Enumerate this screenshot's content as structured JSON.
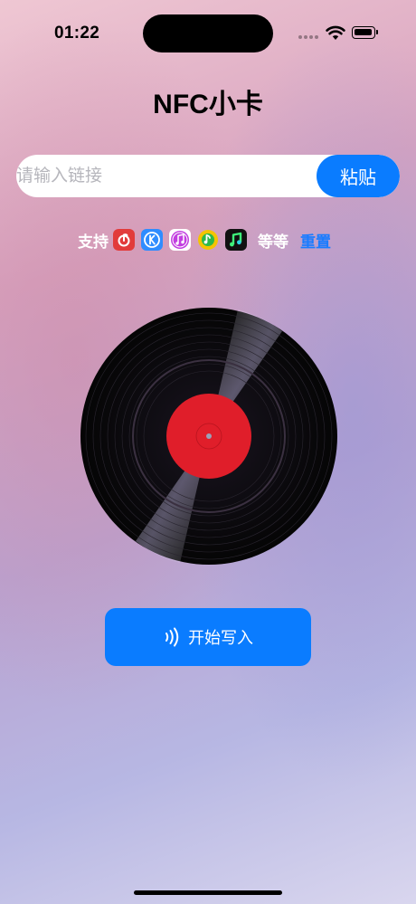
{
  "status_bar": {
    "time": "01:22"
  },
  "header": {
    "title": "NFC小卡"
  },
  "link_input": {
    "placeholder": "请输入链接",
    "value": ""
  },
  "paste_button": {
    "label": "粘贴"
  },
  "support": {
    "label": "支持",
    "apps": [
      {
        "icon": "netease-cloud-music-icon",
        "color": "#e23b3b"
      },
      {
        "icon": "kugou-music-icon",
        "color": "#2f8cff"
      },
      {
        "icon": "apple-music-icon",
        "color": "#c23ee0"
      },
      {
        "icon": "qq-music-icon",
        "color": "#f5c400"
      },
      {
        "icon": "qishui-music-icon",
        "color": "#111111"
      }
    ],
    "etc_label": "等等",
    "reset_label": "重置"
  },
  "start_write_button": {
    "label": "开始写入",
    "icon": "nfc-icon"
  },
  "colors": {
    "accent": "#0a7cff",
    "record_label": "#e01e2a"
  }
}
